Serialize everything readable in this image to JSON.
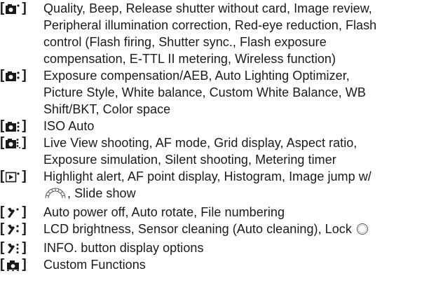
{
  "rows": [
    {
      "icon": "shooting-menu-1-icon",
      "lines": [
        "Quality, Beep, Release shutter without card, Image review,",
        "Peripheral illumination correction, Red-eye reduction, Flash",
        "control (Flash firing, Shutter sync., Flash exposure",
        "compensation, E-TTL II metering, Wireless function)"
      ]
    },
    {
      "icon": "shooting-menu-2-icon",
      "lines": [
        "Exposure compensation/AEB, Auto Lighting Optimizer,",
        "Picture Style, White balance, Custom White Balance, WB",
        "Shift/BKT, Color space"
      ]
    },
    {
      "icon": "shooting-menu-3-icon",
      "lines": [
        "ISO Auto"
      ]
    },
    {
      "icon": "shooting-menu-4-icon",
      "lines": [
        "Live View shooting, AF mode, Grid display, Aspect ratio,",
        "Exposure simulation, Silent shooting, Metering timer"
      ]
    },
    {
      "icon": "playback-menu-1-icon",
      "lines": [
        "Highlight alert, AF point display, Histogram, Image jump w/",
        ", Slide show"
      ]
    },
    {
      "icon": "setup-menu-1-icon",
      "lines": [
        "Auto power off, Auto rotate, File numbering"
      ]
    },
    {
      "icon": "setup-menu-2-icon",
      "lines": [
        "LCD brightness, Sensor cleaning (Auto cleaning), Lock"
      ]
    },
    {
      "icon": "setup-menu-3-icon",
      "lines": [
        "INFO. button display options"
      ]
    },
    {
      "icon": "custom-functions-icon",
      "lines": [
        "Custom Functions"
      ]
    }
  ]
}
